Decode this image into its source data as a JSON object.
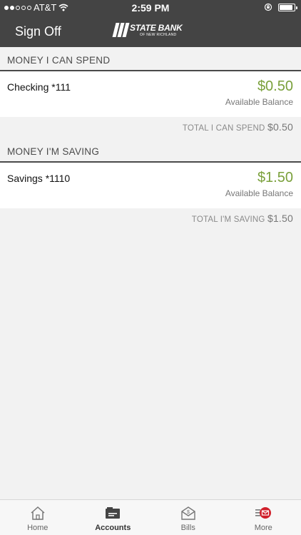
{
  "status_bar": {
    "carrier": "AT&T",
    "time": "2:59 PM",
    "signal_bars_filled": 2,
    "battery_level_fraction": 0.9
  },
  "nav": {
    "sign_off_label": "Sign Off",
    "logo_line1": "STATE BANK",
    "logo_line2": "OF NEW RICHLAND"
  },
  "sections": [
    {
      "header": "MONEY I CAN SPEND",
      "account_name": "Checking *111",
      "amount": "$0.50",
      "balance_label": "Available Balance",
      "total_label": "TOTAL I CAN SPEND",
      "total_value": "$0.50"
    },
    {
      "header": "MONEY I'M SAVING",
      "account_name": "Savings *1110",
      "amount": "$1.50",
      "balance_label": "Available Balance",
      "total_label": "TOTAL I'M SAVING",
      "total_value": "$1.50"
    }
  ],
  "tabs": [
    {
      "label": "Home",
      "icon": "home-icon"
    },
    {
      "label": "Accounts",
      "icon": "accounts-icon"
    },
    {
      "label": "Bills",
      "icon": "bills-icon"
    },
    {
      "label": "More",
      "icon": "more-icon"
    }
  ],
  "colors": {
    "bar_bg": "#444444",
    "positive_amount": "#7aa03b",
    "more_badge": "#d0202b"
  }
}
